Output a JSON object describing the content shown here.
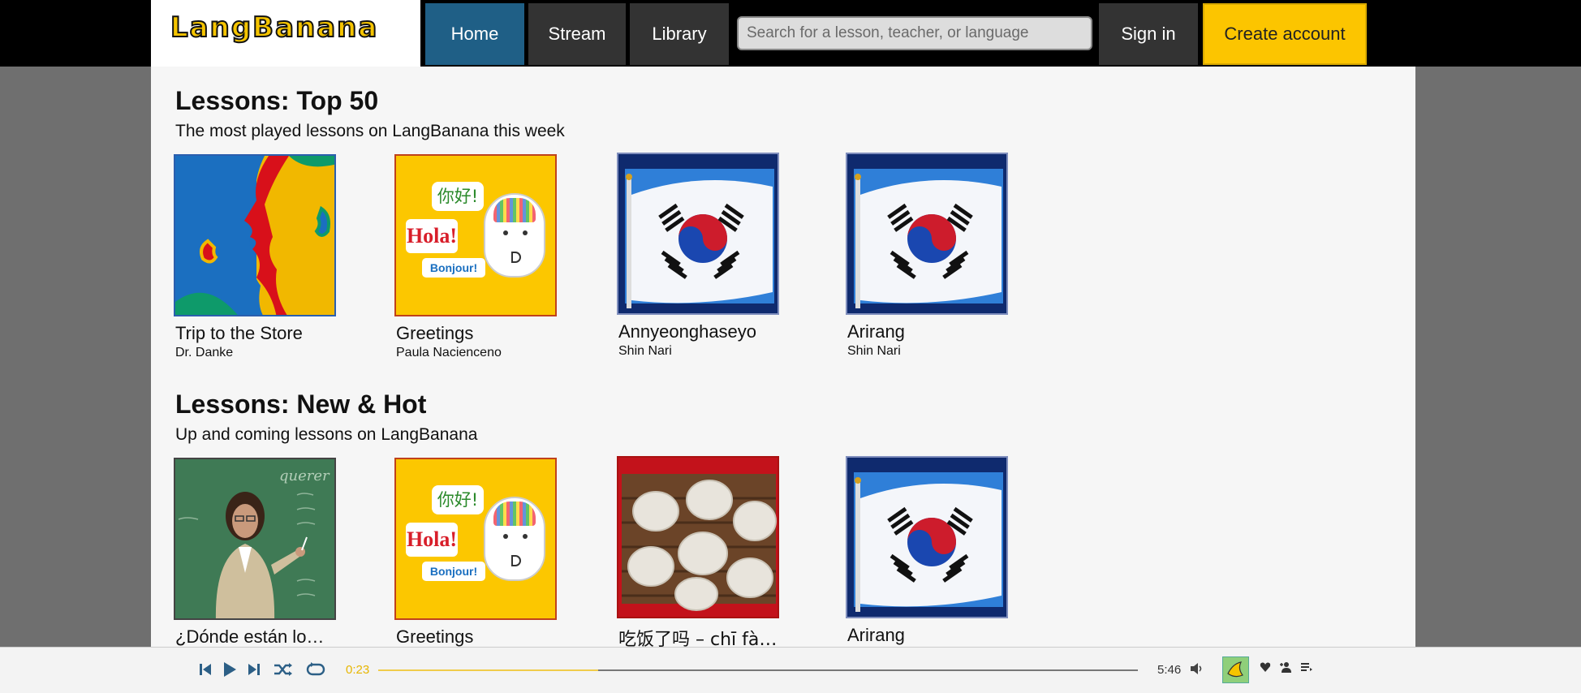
{
  "header": {
    "logo_text": "LangBanana",
    "nav": {
      "home": "Home",
      "stream": "Stream",
      "library": "Library"
    },
    "search_placeholder": "Search for a lesson, teacher, or language",
    "sign_in": "Sign in",
    "create_account": "Create account"
  },
  "sections": {
    "top50": {
      "title": "Lessons: Top 50",
      "subtitle": "The most played lessons on LangBanana this week",
      "cards": [
        {
          "title": "Trip to the Store",
          "author": "Dr. Danke",
          "image": "faces-speaking-art"
        },
        {
          "title": "Greetings",
          "author": "Paula Nacienceno",
          "image": "greetings-hola-bonjour-art"
        },
        {
          "title": "Annyeonghaseyo",
          "author": "Shin Nari",
          "image": "korean-flag"
        },
        {
          "title": "Arirang",
          "author": "Shin Nari",
          "image": "korean-flag"
        }
      ]
    },
    "newhot": {
      "title": "Lessons: New & Hot",
      "subtitle": "Up and coming lessons on LangBanana",
      "cards": [
        {
          "title": "¿Dónde están lo…",
          "image": "teacher-at-chalkboard"
        },
        {
          "title": "Greetings",
          "image": "greetings-hola-bonjour-art"
        },
        {
          "title": "吃饭了吗 – chī fà…",
          "image": "dumplings-steamer"
        },
        {
          "title": "Arirang",
          "image": "korean-flag"
        }
      ]
    }
  },
  "art": {
    "nihao": "你好!",
    "hola": "Hola!",
    "bonjour": "Bonjour!",
    "querer": "querer"
  },
  "player": {
    "current_time": "0:23",
    "total_time": "5:46",
    "progress": 0.29,
    "icons": [
      "skip-back-icon",
      "play-icon",
      "skip-forward-icon",
      "shuffle-icon",
      "repeat-icon",
      "volume-icon",
      "heart-icon",
      "user-add-icon",
      "queue-icon"
    ]
  },
  "colors": {
    "accent_blue": "#1f5f86",
    "accent_yellow": "#fcc500",
    "topbar": "#000000",
    "background": "#6f6f6f"
  }
}
